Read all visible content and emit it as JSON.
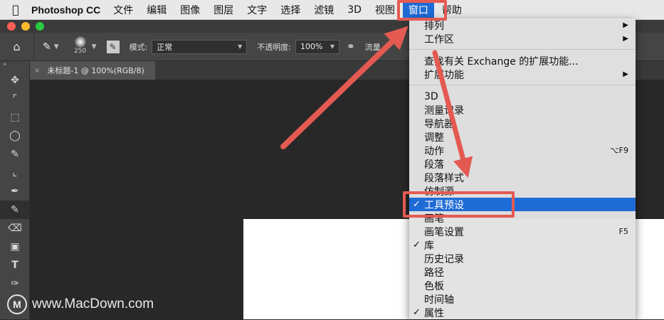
{
  "menubar": {
    "apple_icon": "apple-icon",
    "app_name": "Photoshop CC",
    "items": [
      "文件",
      "编辑",
      "图像",
      "图层",
      "文字",
      "选择",
      "滤镜",
      "3D",
      "视图",
      "窗口",
      "帮助"
    ],
    "active_item": "窗口"
  },
  "options_bar": {
    "brush_size": "250",
    "mode_label": "模式:",
    "mode_value": "正常",
    "opacity_label": "不透明度:",
    "opacity_value": "100%",
    "flow_label": "流量"
  },
  "tab": {
    "close": "×",
    "title": "未标题-1 @ 100%(RGB/8)"
  },
  "window_menu": {
    "items": [
      {
        "label": "排列",
        "submenu": true
      },
      {
        "label": "工作区",
        "submenu": true
      },
      {
        "sep": true
      },
      {
        "label": "查找有关 Exchange 的扩展功能..."
      },
      {
        "label": "扩展功能",
        "submenu": true
      },
      {
        "sep": true
      },
      {
        "label": "3D"
      },
      {
        "label": "测量记录"
      },
      {
        "label": "导航器"
      },
      {
        "label": "调整"
      },
      {
        "label": "动作",
        "shortcut": "⌥F9"
      },
      {
        "label": "段落"
      },
      {
        "label": "段落样式"
      },
      {
        "label": "仿制源"
      },
      {
        "label": "工具预设",
        "checked": true,
        "highlighted": true
      },
      {
        "label": "画笔"
      },
      {
        "label": "画笔设置",
        "shortcut": "F5"
      },
      {
        "label": "库",
        "checked": true
      },
      {
        "label": "历史记录"
      },
      {
        "label": "路径"
      },
      {
        "label": "色板"
      },
      {
        "label": "时间轴"
      },
      {
        "label": "属性",
        "checked": true
      }
    ]
  },
  "watermark": {
    "logo_letter": "M",
    "text": "www.MacDown.com"
  },
  "colors": {
    "highlight": "#1f6bd6",
    "annotation": "#e45a52"
  }
}
